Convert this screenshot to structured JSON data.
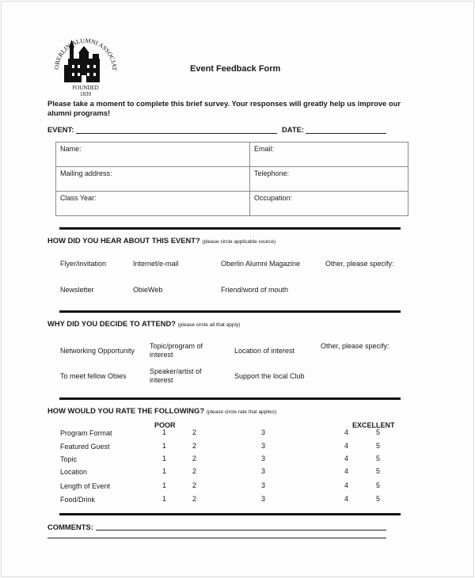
{
  "logo": {
    "icon": "oberlin-alumni-association-seal",
    "arc_text": "OBERLIN ALUMNI ASSOCIATION",
    "founded": "FOUNDED",
    "year": "1839"
  },
  "title": "Event Feedback Form",
  "intro": "Please take a moment to complete this brief survey.  Your responses will greatly help us improve our alumni programs!",
  "event_label": "EVENT:",
  "event_value": "",
  "date_label": "DATE:",
  "date_value": "",
  "info_fields": [
    {
      "label": "Name:",
      "value": ""
    },
    {
      "label": "Email:",
      "value": ""
    },
    {
      "label": "Mailing address:",
      "value": ""
    },
    {
      "label": "Telephone:",
      "value": ""
    },
    {
      "label": "Class Year:",
      "value": ""
    },
    {
      "label": "Occupation:",
      "value": ""
    }
  ],
  "hear": {
    "heading": "HOW DID YOU HEAR ABOUT THIS EVENT?",
    "note": "(please circle applicable source)",
    "options": [
      "Flyer/invitation",
      "Internet/e-mail",
      "Oberlin Alumni Magazine",
      "Other, please specify:",
      "Newsletter",
      "ObieWeb",
      "Friend/word of mouth"
    ]
  },
  "attend": {
    "heading": "WHY DID YOU DECIDE TO ATTEND?",
    "note": "(please circle all that apply)",
    "options": [
      "Networking Opportunity",
      "Topic/program of interest",
      "Location of interest",
      "Other, please specify:",
      "To meet fellow Obies",
      "Speaker/artist of interest",
      "Support the local Club"
    ]
  },
  "rate": {
    "heading": "HOW WOULD YOU RATE THE FOLLOWING?",
    "note": "(please circle rate that applies)",
    "poor_label": "POOR",
    "excellent_label": "EXCELLENT",
    "scale": [
      "1",
      "2",
      "3",
      "4",
      "5"
    ],
    "items": [
      "Program Format",
      "Featured Guest",
      "Topic",
      "Location",
      "Length of Event",
      "Food/Drink"
    ]
  },
  "comments_label": "COMMENTS:",
  "comments_value": ""
}
